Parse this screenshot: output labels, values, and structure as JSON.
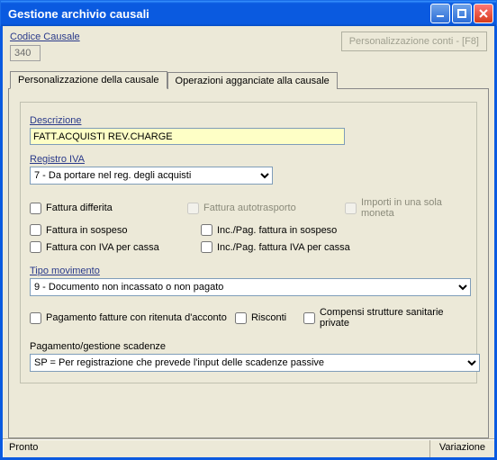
{
  "window": {
    "title": "Gestione archivio causali"
  },
  "header": {
    "codice_label": "Codice Causale",
    "codice_value": "340",
    "personalizzazione_btn": "Personalizzazione conti - [F8]"
  },
  "tabs": {
    "t1": "Personalizzazione della causale",
    "t2": "Operazioni agganciate alla causale"
  },
  "form": {
    "descrizione_label": "Descrizione",
    "descrizione_value": "FATT.ACQUISTI REV.CHARGE",
    "registro_iva_label": "Registro IVA",
    "registro_iva_value": "7 - Da portare nel reg. degli acquisti",
    "chk_fattura_differita": "Fattura differita",
    "chk_fattura_autotrasporto": "Fattura autotrasporto",
    "chk_importi_moneta": "Importi in una sola moneta",
    "chk_fattura_sospeso": "Fattura in sospeso",
    "chk_incpag_fattura_sospeso": "Inc./Pag. fattura in sospeso",
    "chk_fattura_iva_cassa": "Fattura con IVA per cassa",
    "chk_incpag_fattura_iva_cassa": "Inc./Pag. fattura IVA per cassa",
    "tipo_movimento_label": "Tipo movimento",
    "tipo_movimento_value": "9 - Documento non incassato o non pagato",
    "chk_pagamento_ritenuta": "Pagamento fatture con ritenuta d'acconto",
    "chk_risconti": "Risconti",
    "chk_compensi_sanitarie": "Compensi strutture sanitarie private",
    "pagamento_scadenze_label": "Pagamento/gestione scadenze",
    "pagamento_scadenze_value": "SP = Per registrazione che prevede l'input delle scadenze passive"
  },
  "status": {
    "left": "Pronto",
    "right": "Variazione"
  }
}
